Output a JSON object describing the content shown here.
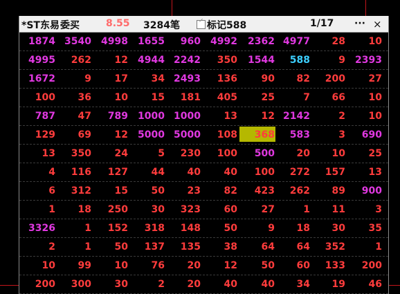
{
  "title": {
    "stock_name": "*ST东易",
    "order_type": "委买",
    "price": "8.55",
    "count": "3284笔",
    "mark_label": "标记588",
    "page": "1/17",
    "more": "···",
    "close": "×"
  },
  "colors": {
    "red": "#ff3c3c",
    "magenta": "#e038e0",
    "cyan": "#3ccfff",
    "highlight": "#b5b800",
    "price": "#ff6b6b"
  },
  "rows": [
    [
      {
        "v": "1874",
        "c": "mag"
      },
      {
        "v": "3540",
        "c": "mag"
      },
      {
        "v": "4998",
        "c": "mag"
      },
      {
        "v": "1655",
        "c": "mag"
      },
      {
        "v": "960",
        "c": "mag"
      },
      {
        "v": "4992",
        "c": "mag"
      },
      {
        "v": "2362",
        "c": "mag"
      },
      {
        "v": "4977",
        "c": "mag"
      },
      {
        "v": "28",
        "c": "red"
      },
      {
        "v": "10",
        "c": "red"
      }
    ],
    [
      {
        "v": "4995",
        "c": "mag"
      },
      {
        "v": "262",
        "c": "red"
      },
      {
        "v": "12",
        "c": "red"
      },
      {
        "v": "4944",
        "c": "mag"
      },
      {
        "v": "2242",
        "c": "mag"
      },
      {
        "v": "350",
        "c": "red"
      },
      {
        "v": "1544",
        "c": "mag"
      },
      {
        "v": "588",
        "c": "cyan"
      },
      {
        "v": "9",
        "c": "red"
      },
      {
        "v": "2393",
        "c": "mag"
      }
    ],
    [
      {
        "v": "1672",
        "c": "mag"
      },
      {
        "v": "9",
        "c": "red"
      },
      {
        "v": "17",
        "c": "red"
      },
      {
        "v": "34",
        "c": "red"
      },
      {
        "v": "2493",
        "c": "mag"
      },
      {
        "v": "136",
        "c": "red"
      },
      {
        "v": "90",
        "c": "red"
      },
      {
        "v": "82",
        "c": "red"
      },
      {
        "v": "200",
        "c": "red"
      },
      {
        "v": "27",
        "c": "red"
      }
    ],
    [
      {
        "v": "100",
        "c": "red"
      },
      {
        "v": "36",
        "c": "red"
      },
      {
        "v": "10",
        "c": "red"
      },
      {
        "v": "15",
        "c": "red"
      },
      {
        "v": "181",
        "c": "red"
      },
      {
        "v": "405",
        "c": "red"
      },
      {
        "v": "25",
        "c": "red"
      },
      {
        "v": "7",
        "c": "red"
      },
      {
        "v": "66",
        "c": "red"
      },
      {
        "v": "10",
        "c": "red"
      }
    ],
    [
      {
        "v": "787",
        "c": "mag"
      },
      {
        "v": "47",
        "c": "red"
      },
      {
        "v": "789",
        "c": "mag"
      },
      {
        "v": "1000",
        "c": "mag"
      },
      {
        "v": "1000",
        "c": "mag"
      },
      {
        "v": "13",
        "c": "red"
      },
      {
        "v": "12",
        "c": "red"
      },
      {
        "v": "2142",
        "c": "mag"
      },
      {
        "v": "2",
        "c": "red"
      },
      {
        "v": "10",
        "c": "red"
      }
    ],
    [
      {
        "v": "129",
        "c": "red"
      },
      {
        "v": "69",
        "c": "red"
      },
      {
        "v": "12",
        "c": "red"
      },
      {
        "v": "5000",
        "c": "mag"
      },
      {
        "v": "5000",
        "c": "mag"
      },
      {
        "v": "108",
        "c": "red"
      },
      {
        "v": "368",
        "c": "hl"
      },
      {
        "v": "583",
        "c": "mag"
      },
      {
        "v": "3",
        "c": "red"
      },
      {
        "v": "690",
        "c": "mag"
      }
    ],
    [
      {
        "v": "13",
        "c": "red"
      },
      {
        "v": "350",
        "c": "red"
      },
      {
        "v": "24",
        "c": "red"
      },
      {
        "v": "5",
        "c": "red"
      },
      {
        "v": "230",
        "c": "red"
      },
      {
        "v": "100",
        "c": "red"
      },
      {
        "v": "500",
        "c": "mag"
      },
      {
        "v": "20",
        "c": "red"
      },
      {
        "v": "10",
        "c": "red"
      },
      {
        "v": "25",
        "c": "red"
      }
    ],
    [
      {
        "v": "4",
        "c": "red"
      },
      {
        "v": "116",
        "c": "red"
      },
      {
        "v": "127",
        "c": "red"
      },
      {
        "v": "44",
        "c": "red"
      },
      {
        "v": "40",
        "c": "red"
      },
      {
        "v": "40",
        "c": "red"
      },
      {
        "v": "100",
        "c": "red"
      },
      {
        "v": "272",
        "c": "red"
      },
      {
        "v": "157",
        "c": "red"
      },
      {
        "v": "13",
        "c": "red"
      }
    ],
    [
      {
        "v": "6",
        "c": "red"
      },
      {
        "v": "312",
        "c": "red"
      },
      {
        "v": "15",
        "c": "red"
      },
      {
        "v": "50",
        "c": "red"
      },
      {
        "v": "23",
        "c": "red"
      },
      {
        "v": "82",
        "c": "red"
      },
      {
        "v": "423",
        "c": "red"
      },
      {
        "v": "262",
        "c": "red"
      },
      {
        "v": "89",
        "c": "red"
      },
      {
        "v": "900",
        "c": "mag"
      }
    ],
    [
      {
        "v": "1",
        "c": "red"
      },
      {
        "v": "18",
        "c": "red"
      },
      {
        "v": "250",
        "c": "red"
      },
      {
        "v": "30",
        "c": "red"
      },
      {
        "v": "323",
        "c": "red"
      },
      {
        "v": "60",
        "c": "red"
      },
      {
        "v": "27",
        "c": "red"
      },
      {
        "v": "1",
        "c": "red"
      },
      {
        "v": "11",
        "c": "red"
      },
      {
        "v": "3",
        "c": "red"
      }
    ],
    [
      {
        "v": "3326",
        "c": "mag"
      },
      {
        "v": "1",
        "c": "red"
      },
      {
        "v": "152",
        "c": "red"
      },
      {
        "v": "318",
        "c": "red"
      },
      {
        "v": "148",
        "c": "red"
      },
      {
        "v": "50",
        "c": "red"
      },
      {
        "v": "9",
        "c": "red"
      },
      {
        "v": "18",
        "c": "red"
      },
      {
        "v": "30",
        "c": "red"
      },
      {
        "v": "35",
        "c": "red"
      }
    ],
    [
      {
        "v": "2",
        "c": "red"
      },
      {
        "v": "1",
        "c": "red"
      },
      {
        "v": "50",
        "c": "red"
      },
      {
        "v": "137",
        "c": "red"
      },
      {
        "v": "135",
        "c": "red"
      },
      {
        "v": "38",
        "c": "red"
      },
      {
        "v": "64",
        "c": "red"
      },
      {
        "v": "64",
        "c": "red"
      },
      {
        "v": "352",
        "c": "red"
      },
      {
        "v": "1",
        "c": "red"
      }
    ],
    [
      {
        "v": "10",
        "c": "red"
      },
      {
        "v": "99",
        "c": "red"
      },
      {
        "v": "10",
        "c": "red"
      },
      {
        "v": "76",
        "c": "red"
      },
      {
        "v": "20",
        "c": "red"
      },
      {
        "v": "12",
        "c": "red"
      },
      {
        "v": "50",
        "c": "red"
      },
      {
        "v": "60",
        "c": "red"
      },
      {
        "v": "133",
        "c": "red"
      },
      {
        "v": "200",
        "c": "red"
      }
    ],
    [
      {
        "v": "200",
        "c": "red"
      },
      {
        "v": "300",
        "c": "red"
      },
      {
        "v": "30",
        "c": "red"
      },
      {
        "v": "2",
        "c": "red"
      },
      {
        "v": "20",
        "c": "red"
      },
      {
        "v": "40",
        "c": "red"
      },
      {
        "v": "40",
        "c": "red"
      },
      {
        "v": "34",
        "c": "red"
      },
      {
        "v": "19",
        "c": "red"
      },
      {
        "v": "46",
        "c": "red"
      }
    ]
  ]
}
